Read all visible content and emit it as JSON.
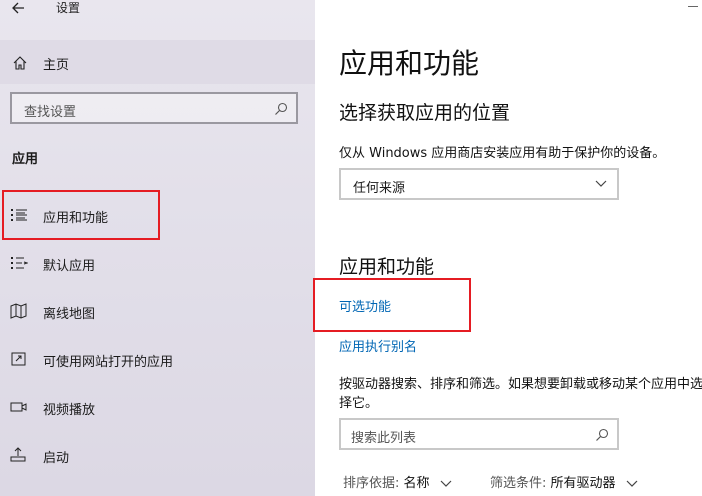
{
  "window": {
    "title": "设置"
  },
  "sidebar": {
    "home_label": "主页",
    "search_placeholder": "查找设置",
    "section_title": "应用",
    "items": [
      {
        "label": "应用和功能",
        "icon": "apps-list-icon",
        "selected": true
      },
      {
        "label": "默认应用",
        "icon": "default-apps-icon"
      },
      {
        "label": "离线地图",
        "icon": "offline-maps-icon"
      },
      {
        "label": "可使用网站打开的应用",
        "icon": "apps-for-websites-icon"
      },
      {
        "label": "视频播放",
        "icon": "video-playback-icon"
      },
      {
        "label": "启动",
        "icon": "startup-icon"
      }
    ]
  },
  "main": {
    "page_title": "应用和功能",
    "install_section": {
      "heading": "选择获取应用的位置",
      "description": "仅从 Windows 应用商店安装应用有助于保护你的设备。",
      "source_value": "任何来源"
    },
    "apps_section": {
      "heading": "应用和功能",
      "optional_features_link": "可选功能",
      "app_alias_link": "应用执行别名",
      "description": "按驱动器搜索、排序和筛选。如果想要卸载或移动某个应用中选择它。",
      "search_placeholder": "搜索此列表",
      "sort_label": "排序依据:",
      "sort_value": "名称",
      "filter_label": "筛选条件:",
      "filter_value": "所有驱动器"
    }
  },
  "colors": {
    "accent": "#0066b4",
    "highlight_box": "#e51c23"
  }
}
